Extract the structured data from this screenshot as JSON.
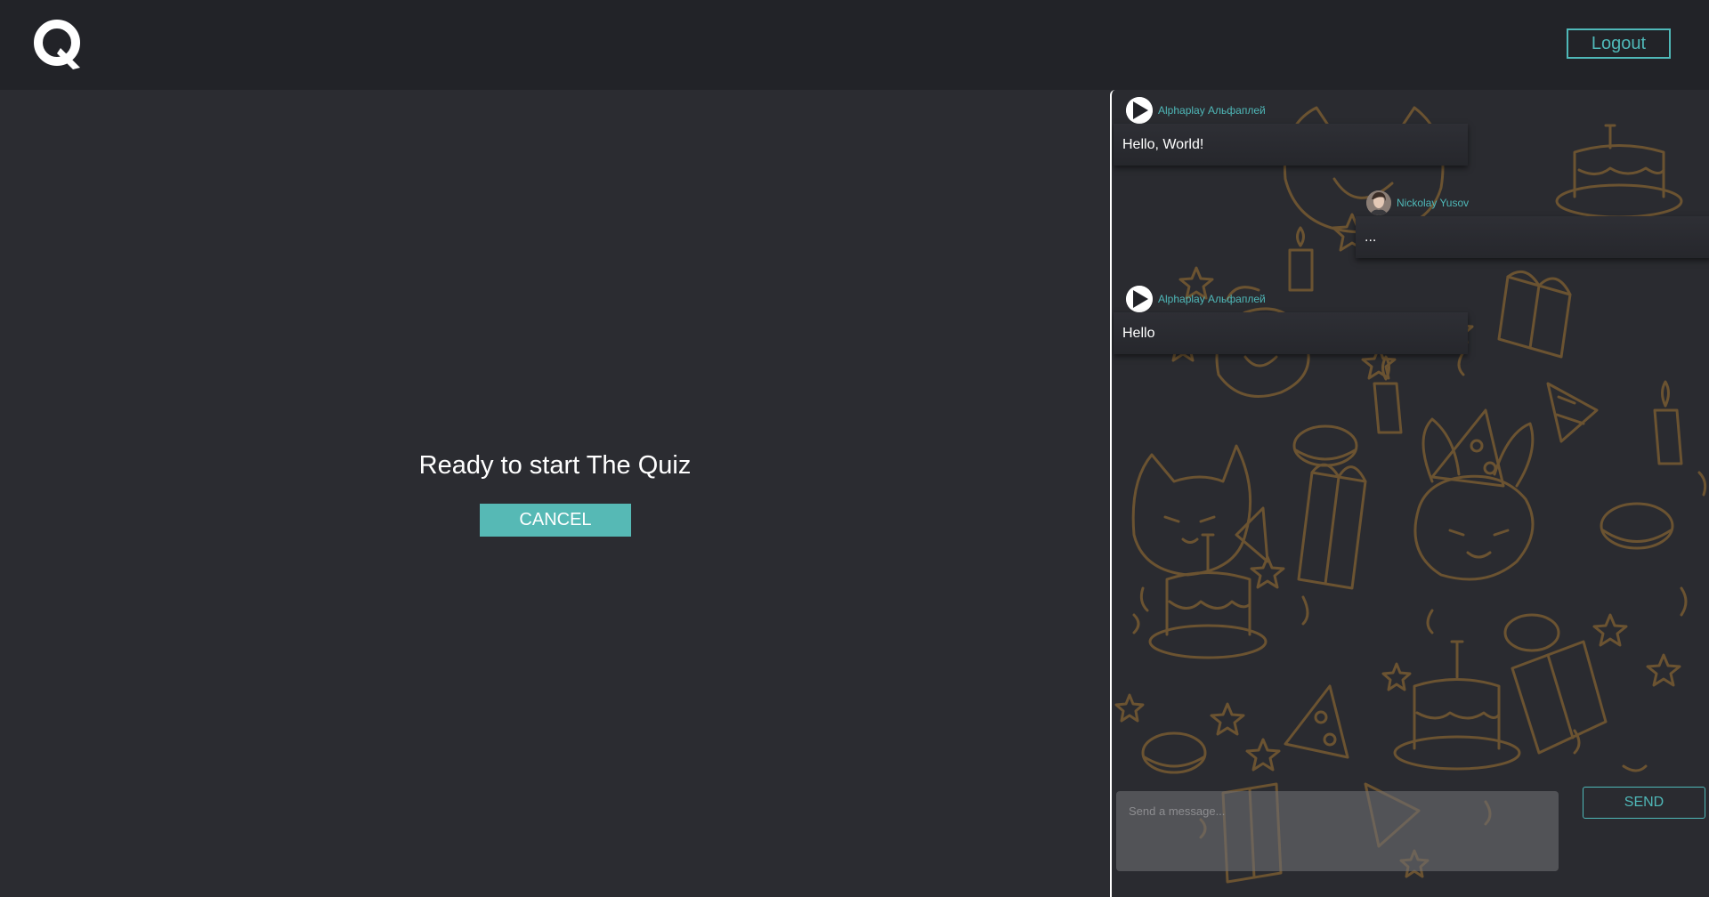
{
  "header": {
    "logo_letter": "Q",
    "logout_label": "Logout"
  },
  "main": {
    "title": "Ready to start The Quiz",
    "cancel_label": "CANCEL"
  },
  "chat": {
    "messages": [
      {
        "author": "Alphaplay Альфаплей",
        "text": "Hello, World!",
        "side": "left",
        "avatar": "alphaplay-logo-icon"
      },
      {
        "author": "Nickolay Yusov",
        "text": "...",
        "side": "right",
        "avatar": "user-photo-avatar"
      },
      {
        "author": "Alphaplay Альфаплей",
        "text": "Hello",
        "side": "left",
        "avatar": "alphaplay-logo-icon"
      }
    ],
    "input_placeholder": "Send a message...",
    "send_label": "SEND"
  },
  "colors": {
    "accent": "#4fb8b8",
    "header_bg": "#222328",
    "page_bg": "#2b2c31",
    "doodle": "#6b5331"
  }
}
